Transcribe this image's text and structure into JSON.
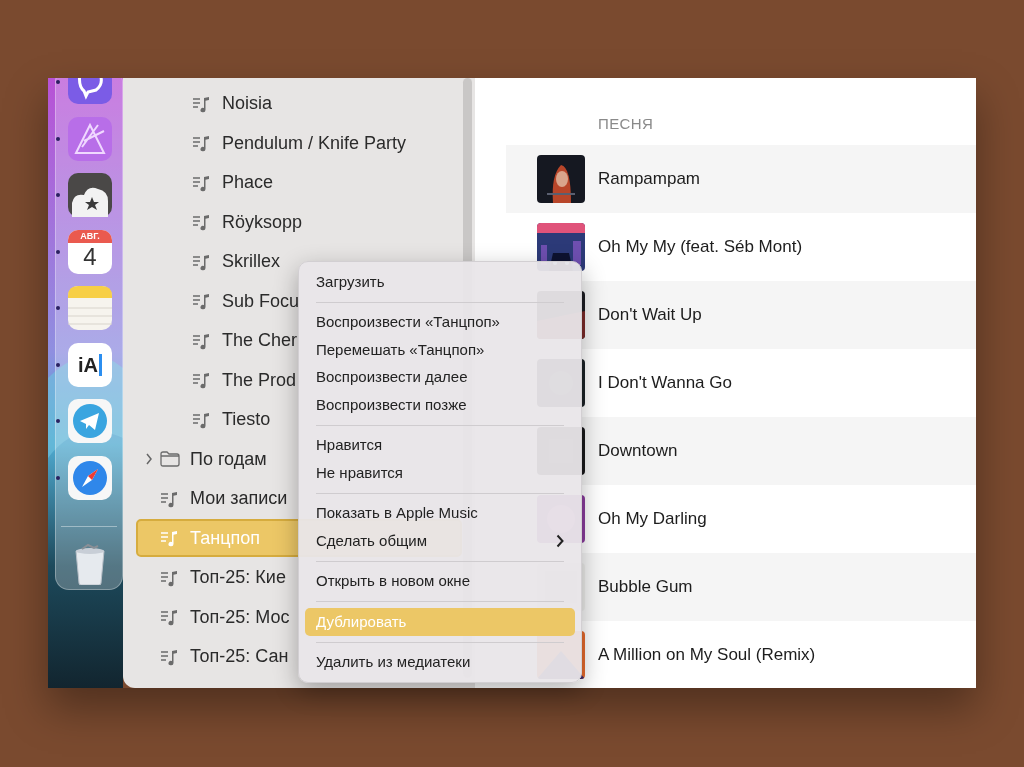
{
  "dock": {
    "items": [
      {
        "kind": "viber",
        "running": true
      },
      {
        "kind": "affinity",
        "running": true
      },
      {
        "kind": "cloud",
        "running": true
      },
      {
        "kind": "calendar",
        "running": true,
        "month": "АВГ.",
        "day": "4"
      },
      {
        "kind": "notes",
        "running": true
      },
      {
        "kind": "ia",
        "running": true,
        "label": "iA"
      },
      {
        "kind": "telegram",
        "running": true
      },
      {
        "kind": "safari",
        "running": true
      },
      {
        "kind": "divider"
      },
      {
        "kind": "trash",
        "running": false
      }
    ]
  },
  "sidebar": {
    "items": [
      {
        "children": [
          {
            "kind": "playlist",
            "label": "Noisia",
            "selected": false
          },
          {
            "kind": "playlist",
            "label": "Pendulum / Knife Party",
            "selected": false
          },
          {
            "kind": "playlist",
            "label": "Phace",
            "selected": false
          },
          {
            "kind": "playlist",
            "label": "Röyksopp",
            "selected": false
          },
          {
            "kind": "playlist",
            "label": "Skrillex",
            "selected": false
          },
          {
            "kind": "playlist",
            "label": "Sub Focu",
            "selected": false
          },
          {
            "kind": "playlist",
            "label": "The Cher",
            "selected": false
          },
          {
            "kind": "playlist",
            "label": "The Prod",
            "selected": false
          },
          {
            "kind": "playlist",
            "label": "Tiesto",
            "selected": false
          }
        ]
      },
      {
        "kind": "folder",
        "label": "По годам",
        "expanded": false,
        "selected": false
      },
      {
        "kind": "playlist",
        "label": "Мои записи",
        "selected": false
      },
      {
        "kind": "playlist",
        "label": "Танцпоп",
        "selected": true
      },
      {
        "kind": "playlist",
        "label": "Топ-25: Кие",
        "selected": false
      },
      {
        "kind": "playlist",
        "label": "Топ-25: Мос",
        "selected": false
      },
      {
        "kind": "playlist",
        "label": "Топ-25: Сан",
        "selected": false
      }
    ]
  },
  "songs": {
    "column": "ПЕСНЯ",
    "rows": [
      {
        "title": "Rampampam"
      },
      {
        "title": "Oh My My (feat. Séb Mont)"
      },
      {
        "title": "Don't Wait Up"
      },
      {
        "title": "I Don't Wanna Go"
      },
      {
        "title": "Downtown"
      },
      {
        "title": "Oh My Darling"
      },
      {
        "title": "Bubble Gum"
      },
      {
        "title": "A Million on My Soul (Remix)"
      }
    ]
  },
  "context_menu": {
    "items": [
      {
        "kind": "item",
        "label": "Загрузить",
        "selected": false
      },
      {
        "kind": "separator"
      },
      {
        "kind": "item",
        "label": "Воспроизвести «Танцпоп»",
        "selected": false
      },
      {
        "kind": "item",
        "label": "Перемешать «Танцпоп»",
        "selected": false
      },
      {
        "kind": "item",
        "label": "Воспроизвести далее",
        "selected": false
      },
      {
        "kind": "item",
        "label": "Воспроизвести позже",
        "selected": false
      },
      {
        "kind": "separator"
      },
      {
        "kind": "item",
        "label": "Нравится",
        "selected": false
      },
      {
        "kind": "item",
        "label": "Не нравится",
        "selected": false
      },
      {
        "kind": "separator"
      },
      {
        "kind": "item",
        "label": "Показать в Apple Music",
        "selected": false
      },
      {
        "kind": "submenu",
        "label": "Сделать общим",
        "selected": false
      },
      {
        "kind": "separator"
      },
      {
        "kind": "item",
        "label": "Открыть в новом окне",
        "selected": false
      },
      {
        "kind": "separator"
      },
      {
        "kind": "item",
        "label": "Дублировать",
        "selected": true
      },
      {
        "kind": "separator"
      },
      {
        "kind": "item",
        "label": "Удалить из медиатеки",
        "selected": false
      }
    ]
  }
}
